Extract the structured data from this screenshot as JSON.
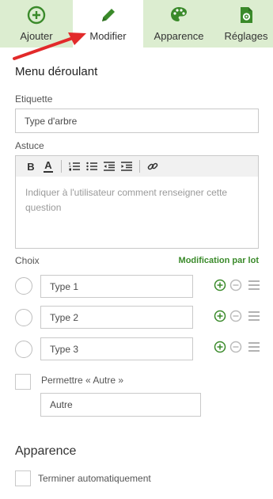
{
  "tabs": {
    "add": {
      "label": "Ajouter",
      "icon": "plus-circle-icon"
    },
    "edit": {
      "label": "Modifier",
      "icon": "pencil-icon"
    },
    "appearance": {
      "label": "Apparence",
      "icon": "palette-icon"
    },
    "settings": {
      "label": "Réglages",
      "icon": "settings-gear-icon"
    }
  },
  "colors": {
    "tab_bar": "#dcedd0",
    "accent_green": "#3a8a2a",
    "arrow_red": "#e22a2a"
  },
  "form": {
    "section_title": "Menu déroulant",
    "label_field": {
      "label": "Etiquette",
      "value": "Type d'arbre"
    },
    "hint_field": {
      "label": "Astuce",
      "placeholder": "Indiquer à l'utilisateur comment renseigner cette question"
    },
    "toolbar": {
      "bold": "B",
      "text_color": "A"
    },
    "choices": {
      "label": "Choix",
      "batch_edit": "Modification par lot",
      "items": [
        {
          "value": "Type 1"
        },
        {
          "value": "Type 2"
        },
        {
          "value": "Type 3"
        }
      ]
    },
    "other": {
      "label": "Permettre « Autre »",
      "value": "Autre"
    },
    "appearance": {
      "title": "Apparence",
      "autocomplete_label": "Terminer automatiquement"
    }
  }
}
